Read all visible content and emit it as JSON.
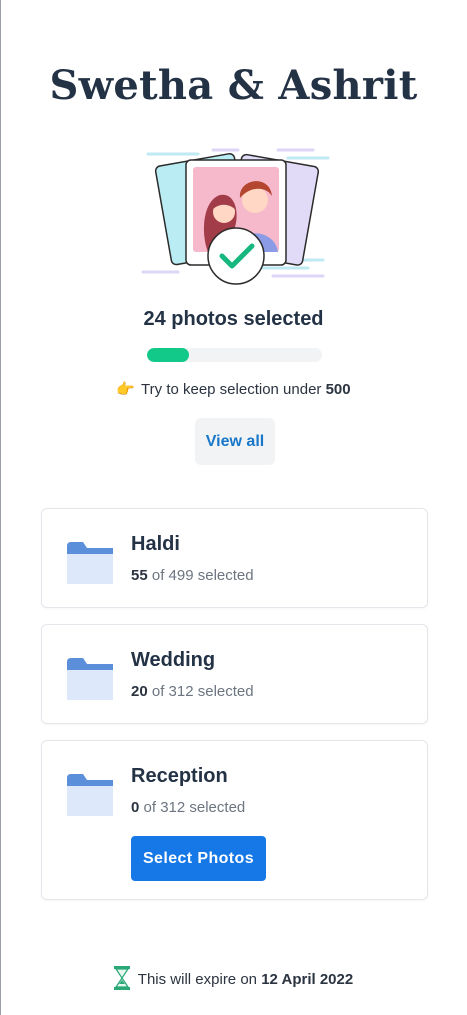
{
  "title": "Swetha & Ashrit",
  "summary": {
    "count_text": "24 photos selected",
    "progress_fraction": 0.24
  },
  "tip": {
    "icon": "pointing-hand-icon",
    "prefix": "Try to keep selection under",
    "limit": "500"
  },
  "view_all_label": "View all",
  "albums": [
    {
      "name": "Haldi",
      "selected": "55",
      "rest": "of 499 selected"
    },
    {
      "name": "Wedding",
      "selected": "20",
      "rest": "of 312 selected"
    },
    {
      "name": "Reception",
      "selected": "0",
      "rest": "of 312 selected",
      "button_label": "Select Photos"
    }
  ],
  "footer": {
    "icon": "hourglass-icon",
    "prefix": "This will expire on",
    "date": "12 April 2022"
  },
  "colors": {
    "accent": "#1677e6",
    "progress": "#13c98a",
    "folder": "#5b8fd9",
    "heading": "#233245"
  }
}
